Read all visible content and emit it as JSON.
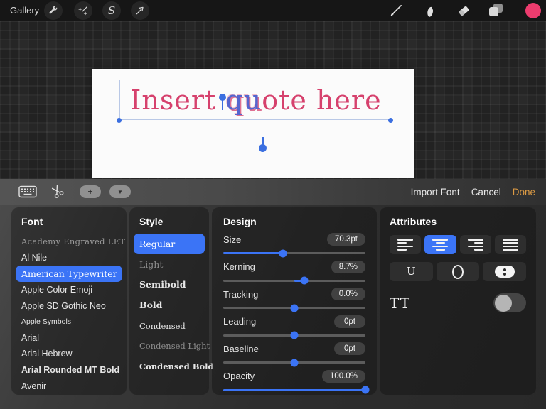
{
  "theme": {
    "accent": "#3b74f6",
    "done": "#dd9b44",
    "swatch": "#ed3c6e",
    "canvas_text": "#d6416d",
    "selected_text": "#5565cf",
    "handle": "#3b6fe0"
  },
  "top_toolbar": {
    "gallery_label": "Gallery",
    "selection_glyph": "S"
  },
  "canvas": {
    "text_before": "Insert ",
    "text_selected": "qu",
    "text_after": "ote here"
  },
  "text_toolbar": {
    "plus_glyph": "+",
    "chevron_glyph": "▼",
    "import_font_label": "Import Font",
    "cancel_label": "Cancel",
    "done_label": "Done"
  },
  "font_panel": {
    "header": "Font",
    "items": [
      {
        "label": "Academy Engraved LET",
        "selected": false
      },
      {
        "label": "Al Nile",
        "selected": false
      },
      {
        "label": "American Typewriter",
        "selected": true
      },
      {
        "label": "Apple Color Emoji",
        "selected": false
      },
      {
        "label": "Apple SD Gothic Neo",
        "selected": false
      },
      {
        "label": "Apple Symbols",
        "selected": false
      },
      {
        "label": "Arial",
        "selected": false
      },
      {
        "label": "Arial Hebrew",
        "selected": false
      },
      {
        "label": "Arial Rounded MT Bold",
        "selected": false
      },
      {
        "label": "Avenir",
        "selected": false
      }
    ]
  },
  "style_panel": {
    "header": "Style",
    "items": [
      {
        "label": "Regular",
        "selected": true
      },
      {
        "label": "Light",
        "selected": false
      },
      {
        "label": "Semibold",
        "selected": false
      },
      {
        "label": "Bold",
        "selected": false
      },
      {
        "label": "Condensed",
        "selected": false
      },
      {
        "label": "Condensed Light",
        "selected": false
      },
      {
        "label": "Condensed Bold",
        "selected": false
      }
    ]
  },
  "design_panel": {
    "header": "Design",
    "sliders": [
      {
        "label": "Size",
        "value": "70.3pt",
        "fill_start": 0,
        "fill_end": 42
      },
      {
        "label": "Kerning",
        "value": "8.7%",
        "fill_start": 50,
        "fill_end": 57
      },
      {
        "label": "Tracking",
        "value": "0.0%",
        "fill_start": 50,
        "fill_end": 50
      },
      {
        "label": "Leading",
        "value": "0pt",
        "fill_start": 50,
        "fill_end": 50
      },
      {
        "label": "Baseline",
        "value": "0pt",
        "fill_start": 50,
        "fill_end": 50
      },
      {
        "label": "Opacity",
        "value": "100.0%",
        "fill_start": 0,
        "fill_end": 100
      }
    ]
  },
  "attributes_panel": {
    "header": "Attributes",
    "selected_alignment": "center",
    "underline_glyph": "U",
    "tt_label": "TT",
    "toggle_on": false
  }
}
